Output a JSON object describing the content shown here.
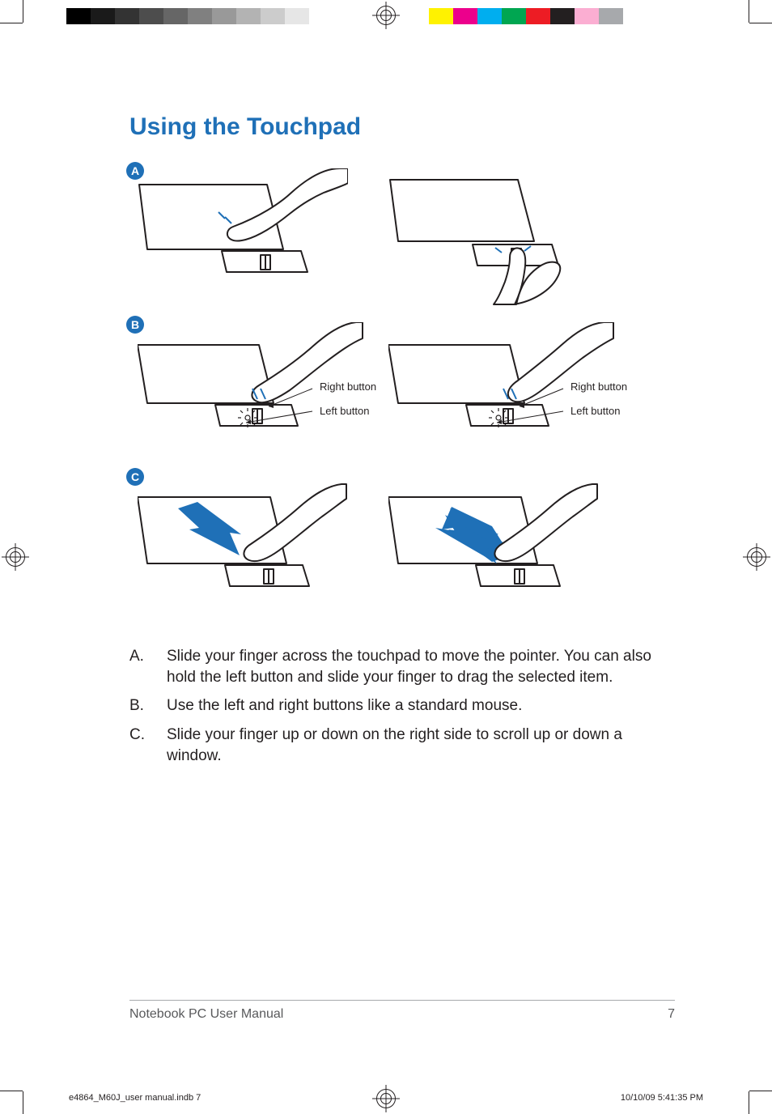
{
  "title": "Using the Touchpad",
  "badges": {
    "a": "A",
    "b": "B",
    "c": "C"
  },
  "labels": {
    "right_button": "Right button",
    "left_button": "Left button"
  },
  "list": {
    "a_letter": "A.",
    "a_text": "Slide your finger across the touchpad to move the pointer. You can also hold the left button and slide your finger to drag the selected item.",
    "b_letter": "B.",
    "b_text": "Use the left and right buttons like a standard mouse.",
    "c_letter": "C.",
    "c_text": "Slide your finger up or down on the right side to scroll up or down a window."
  },
  "footer": {
    "manual_name": "Notebook PC User Manual",
    "page_number": "7"
  },
  "slug": {
    "file": "e4864_M60J_user manual.indb   7",
    "timestamp": "10/10/09   5:41:35 PM"
  },
  "gray_swatches": [
    "#000000",
    "#1a1a1a",
    "#333333",
    "#4d4d4d",
    "#666666",
    "#808080",
    "#999999",
    "#b3b3b3",
    "#cccccc",
    "#e6e6e6"
  ],
  "color_swatches": [
    "#fff200",
    "#ec008c",
    "#00aeef",
    "#00a651",
    "#ed1c24",
    "#231f20",
    "#fbaed2",
    "#a7a9ac"
  ]
}
